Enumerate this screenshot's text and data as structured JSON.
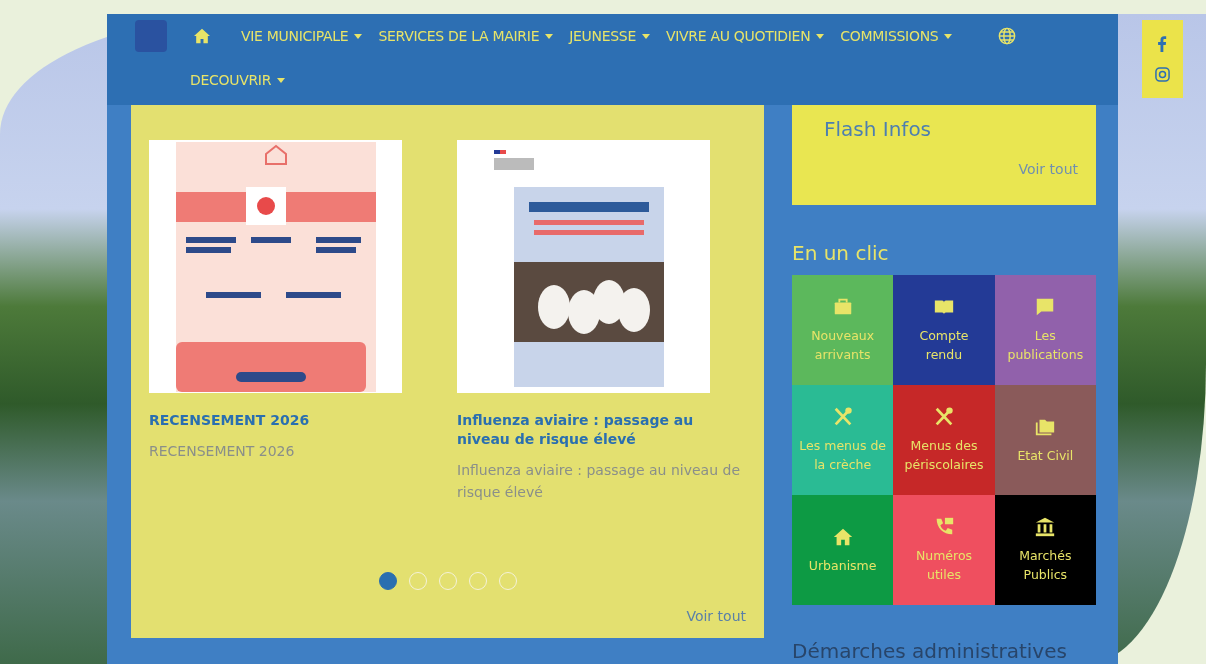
{
  "nav": {
    "items": [
      {
        "label": "VIE MUNICIPALE"
      },
      {
        "label": "SERVICES DE LA MAIRIE"
      },
      {
        "label": "JEUNESSE"
      },
      {
        "label": "VIVRE AU QUOTIDIEN"
      },
      {
        "label": "COMMISSIONS"
      },
      {
        "label": "DECOUVRIR"
      }
    ]
  },
  "news": {
    "cards": [
      {
        "kind": "census",
        "title": "RECENSEMENT 2026",
        "summary": "RECENSEMENT 2026"
      },
      {
        "kind": "poultry",
        "title": "Influenza aviaire : passage au niveau de risque élevé",
        "summary": "Influenza aviaire : passage au niveau de risque élevé"
      }
    ],
    "dots": [
      {
        "selected": true
      },
      {
        "selected": false
      },
      {
        "selected": false
      },
      {
        "selected": false
      },
      {
        "selected": false
      }
    ],
    "more_link": "Voir tout"
  },
  "flash": {
    "title": "Flash Infos",
    "more_link": "Voir tout"
  },
  "quick_links": {
    "title": "En un clic",
    "tiles": [
      {
        "kind": "briefcase",
        "label": "Nouveaux arrivants",
        "color": "#5cb85c"
      },
      {
        "kind": "book",
        "label": "Compte rendu",
        "color": "#233a96"
      },
      {
        "kind": "alert",
        "label": "Les publications",
        "color": "#9161ab"
      },
      {
        "kind": "cutlery",
        "label": "Les menus de la crèche",
        "color": "#2abb94"
      },
      {
        "kind": "cutlery",
        "label": "Menus des périscolaires",
        "color": "#c62828"
      },
      {
        "kind": "images",
        "label": "Etat Civil",
        "color": "#8a5a5a"
      },
      {
        "kind": "home",
        "label": "Urbanisme",
        "color": "#0d9a44"
      },
      {
        "kind": "phone",
        "label": "Numéros utiles",
        "color": "#ef4f5f"
      },
      {
        "kind": "bank",
        "label": "Marchés Publics",
        "color": "#000000"
      }
    ]
  },
  "procedures": {
    "title": "Démarches administratives"
  }
}
